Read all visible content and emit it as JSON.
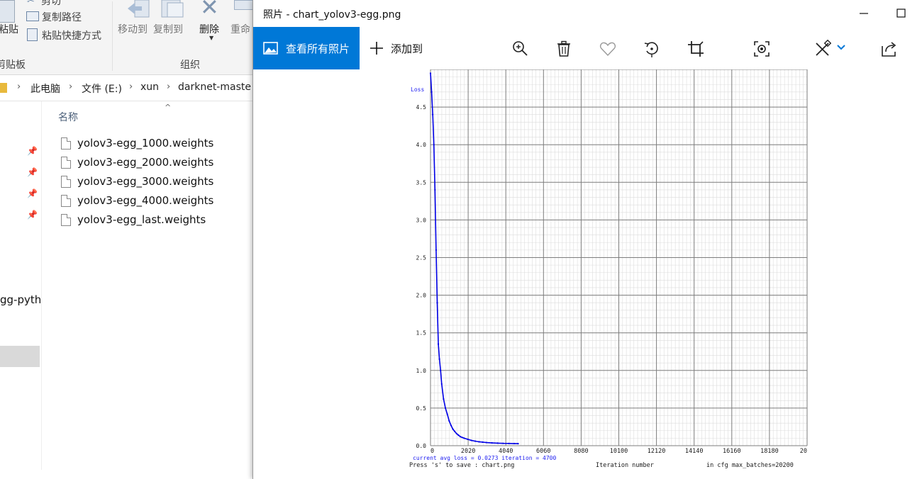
{
  "explorer": {
    "ribbon": {
      "cut_label": "剪切",
      "paste_label": "粘贴",
      "copy_path_label": "复制路径",
      "paste_shortcut_label": "粘贴快捷方式",
      "clipboard_group": "剪贴板",
      "move_to_label": "移动到",
      "copy_to_label": "复制到",
      "delete_label": "删除",
      "rename_label": "重命",
      "organize_group": "组织"
    },
    "breadcrumb": [
      "此电脑",
      "文件 (E:)",
      "xun",
      "darknet-maste"
    ],
    "nav_item_partial": "gg-pyth",
    "column_name": "名称",
    "files": [
      "yolov3-egg_1000.weights",
      "yolov3-egg_2000.weights",
      "yolov3-egg_3000.weights",
      "yolov3-egg_4000.weights",
      "yolov3-egg_last.weights"
    ]
  },
  "photos": {
    "window_title": "照片 - chart_yolov3-egg.png",
    "view_all_label": "查看所有照片",
    "add_to_label": "添加到",
    "accent": "#0078d7",
    "toolbar_icons": [
      "zoom-in-icon",
      "delete-icon",
      "favorite-icon",
      "rotate-icon",
      "crop-icon",
      "enhance-icon",
      "edit-icon",
      "share-icon"
    ]
  },
  "chart_data": {
    "type": "line",
    "ylabel": "Loss",
    "yticks": [
      "0.0",
      "0.5",
      "1.0",
      "1.5",
      "2.0",
      "2.5",
      "3.0",
      "3.5",
      "4.0",
      "4.5"
    ],
    "xticks": [
      "0",
      "2020",
      "4040",
      "6060",
      "8080",
      "10100",
      "12120",
      "14140",
      "16160",
      "18180",
      "20"
    ],
    "xlim": [
      0,
      20200
    ],
    "ylim": [
      0,
      5
    ],
    "series": [
      {
        "x": [
          0,
          60,
          120,
          180,
          240,
          300,
          360,
          420,
          480,
          540,
          600,
          700,
          800,
          900,
          1000,
          1100,
          1200,
          1300,
          1400,
          1500,
          1600,
          1700,
          1800,
          2000,
          2200,
          2400,
          2600,
          2800,
          3000,
          3300,
          3600,
          3900,
          4200,
          4500,
          4700
        ],
        "y": [
          4.95,
          4.7,
          4.4,
          4.0,
          3.4,
          2.6,
          1.9,
          1.35,
          1.15,
          1.0,
          0.82,
          0.62,
          0.5,
          0.42,
          0.33,
          0.27,
          0.22,
          0.19,
          0.16,
          0.14,
          0.12,
          0.11,
          0.1,
          0.085,
          0.07,
          0.06,
          0.052,
          0.047,
          0.042,
          0.037,
          0.034,
          0.031,
          0.03,
          0.028,
          0.0273
        ]
      }
    ],
    "status_current": "current avg loss = 0.0273    iteration = 4700",
    "status_save": "Press 's' to save : chart.png",
    "xlabel": "Iteration number",
    "status_maxbatches": "in cfg max_batches=20200",
    "grid": true
  }
}
